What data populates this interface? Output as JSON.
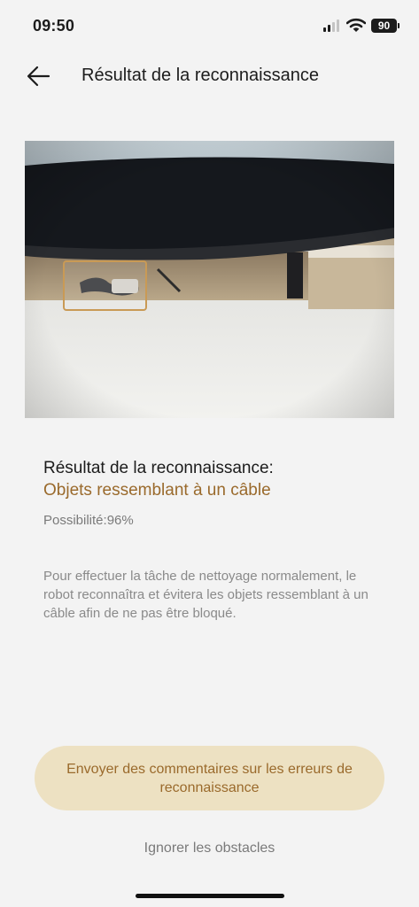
{
  "status_bar": {
    "time": "09:50",
    "battery": "90",
    "icons": [
      "signal-icon",
      "wifi-icon",
      "battery-icon"
    ]
  },
  "header": {
    "back_icon": "arrow-left-icon",
    "title": "Résultat de la reconnaissance"
  },
  "recognition": {
    "label": "Résultat de la reconnaissance:",
    "object": "Objets ressemblant à un câble",
    "possibility_label": "Possibilité:",
    "possibility_value": "96%",
    "description": "Pour effectuer la tâche de nettoyage normalement, le robot reconnaîtra et évitera les objets ressemblant à un câble afin de ne pas être bloqué."
  },
  "actions": {
    "feedback_button": "Envoyer des commentaires sur les erreurs de reconnaissance",
    "ignore_link": "Ignorer les obstacles"
  },
  "colors": {
    "accent": "#9a6a2c",
    "button_bg": "#ede1c2",
    "background": "#f3f3f3",
    "detection_box": "#c99a55"
  }
}
